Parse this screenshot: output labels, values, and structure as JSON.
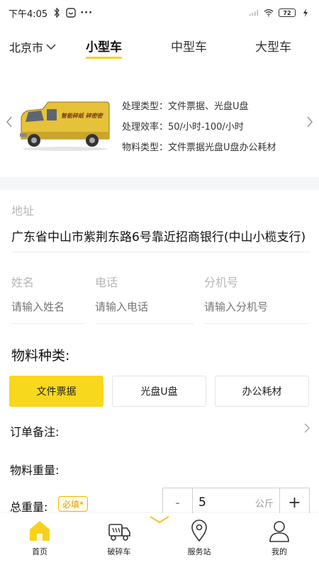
{
  "status_bar": {
    "time": "下午4:05",
    "more": "···",
    "battery": "72"
  },
  "header": {
    "city": "北京市",
    "tabs": [
      {
        "label": "小型车",
        "active": true
      },
      {
        "label": "中型车",
        "active": false
      },
      {
        "label": "大型车",
        "active": false
      }
    ]
  },
  "vehicle": {
    "van_text": "智能碎纸 碎密密",
    "info": [
      "处理类型：文件票据、光盘U盘",
      "处理效率：50/小时-100/小时",
      "物料类型：文件票据光盘U盘办公耗材"
    ]
  },
  "form": {
    "address_label": "地址",
    "address_value": "广东省中山市紫荆东路6号靠近招商银行(中山小榄支行)",
    "name_label": "姓名",
    "name_placeholder": "请输入姓名",
    "phone_label": "电话",
    "phone_placeholder": "请输入电话",
    "ext_label": "分机号",
    "ext_placeholder": "请输入分机号",
    "material_title": "物料种类:",
    "materials": [
      {
        "label": "文件票据",
        "selected": true
      },
      {
        "label": "光盘U盘",
        "selected": false
      },
      {
        "label": "办公耗材",
        "selected": false
      }
    ],
    "order_note_label": "订单备注:",
    "weight_label": "物料重量:",
    "total_weight_label": "总重量:",
    "required_badge": "必填*",
    "stepper": {
      "minus": "-",
      "value": "5",
      "unit": "公斤",
      "plus": "+"
    }
  },
  "bottom_nav": [
    {
      "label": "首页",
      "icon": "home-icon",
      "active": true
    },
    {
      "label": "破碎车",
      "icon": "truck-icon",
      "active": false
    },
    {
      "label": "服务站",
      "icon": "location-pin-icon",
      "active": false
    },
    {
      "label": "我的",
      "icon": "user-icon",
      "active": false
    }
  ],
  "colors": {
    "accent": "#f7d81d",
    "muted": "#b7b7b7"
  }
}
